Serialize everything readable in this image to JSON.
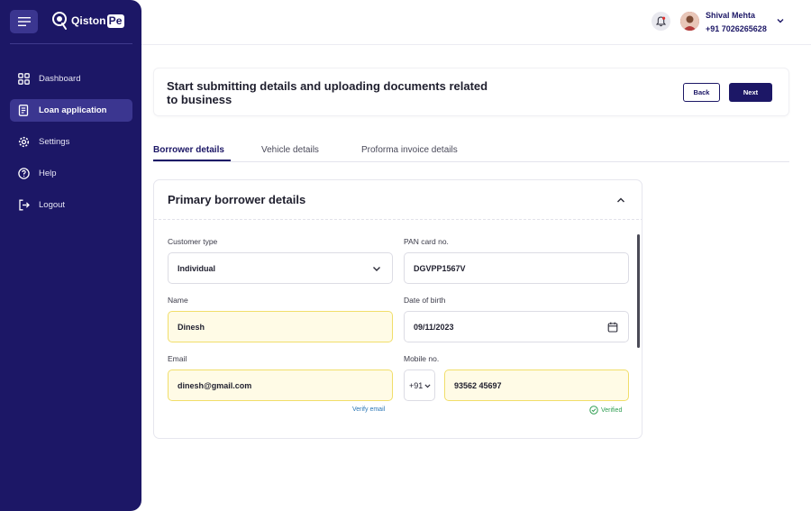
{
  "brand": {
    "name": "Qiston",
    "suffix": "Pe"
  },
  "sidebar": {
    "items": [
      {
        "label": "Dashboard",
        "icon": "grid-icon",
        "active": false
      },
      {
        "label": "Loan application",
        "icon": "document-icon",
        "active": true
      },
      {
        "label": "Settings",
        "icon": "gear-icon",
        "active": false
      },
      {
        "label": "Help",
        "icon": "help-icon",
        "active": false
      },
      {
        "label": "Logout",
        "icon": "logout-icon",
        "active": false
      }
    ]
  },
  "user": {
    "name": "Shival Mehta",
    "phone": "+91 7026265628"
  },
  "header": {
    "title": "Start submitting details and uploading documents related to business",
    "back_label": "Back",
    "next_label": "Next"
  },
  "tabs": [
    {
      "label": "Borrower details",
      "active": true
    },
    {
      "label": "Vehicle details",
      "active": false
    },
    {
      "label": "Proforma invoice details",
      "active": false
    }
  ],
  "card": {
    "title": "Primary borrower details",
    "fields": {
      "customer_type": {
        "label": "Customer type",
        "value": "Individual"
      },
      "pan": {
        "label": "PAN card no.",
        "value": "DGVPP1567V"
      },
      "name": {
        "label": "Name",
        "value": "Dinesh"
      },
      "dob": {
        "label": "Date of birth",
        "value": "09/11/2023"
      },
      "email": {
        "label": "Email",
        "value": "dinesh@gmail.com",
        "action": "Verify email"
      },
      "mobile": {
        "label": "Mobile no.",
        "country_code": "+91",
        "value": "93562 45697",
        "status": "Verified"
      }
    }
  },
  "colors": {
    "sidebar_bg": "#1c1766",
    "accent": "#1c1766",
    "highlight_bg": "#fffbe6",
    "highlight_border": "#f1de6a",
    "link": "#2a76b5",
    "verified": "#2f9e52"
  }
}
